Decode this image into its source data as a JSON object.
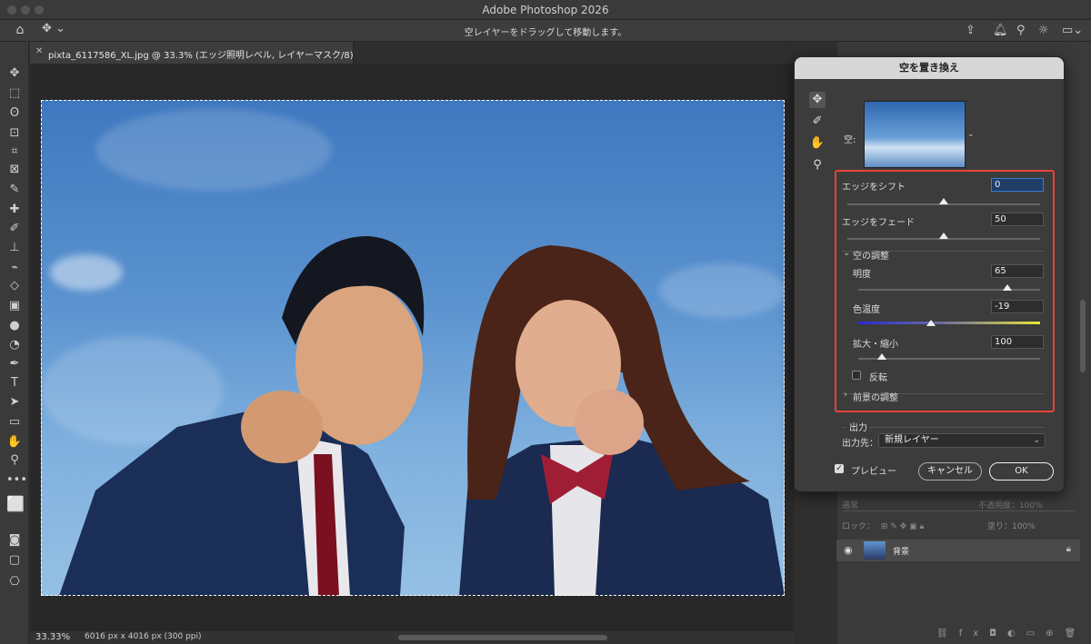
{
  "app": {
    "title": "Adobe Photoshop 2026"
  },
  "options_bar": {
    "hint": "空レイヤーをドラッグして移動します。"
  },
  "document": {
    "tab_title": "pixta_6117586_XL.jpg @ 33.3% (エッジ照明レベル, レイヤーマスク/8)",
    "zoom": "33.33%",
    "info": "6016 px x 4016 px (300 ppi)"
  },
  "dialog": {
    "title": "空を置き換え",
    "sky_label": "空:",
    "edge_shift": {
      "label": "エッジをシフト",
      "value": "0",
      "fraction": 0.5
    },
    "edge_fade": {
      "label": "エッジをフェード",
      "value": "50",
      "fraction": 0.5
    },
    "sky_adjust": {
      "header": "空の調整",
      "brightness": {
        "label": "明度",
        "value": "65",
        "fraction": 0.82
      },
      "temperature": {
        "label": "色温度",
        "value": "-19",
        "fraction": 0.4
      },
      "scale": {
        "label": "拡大・縮小",
        "value": "100",
        "fraction": 0.13
      },
      "flip_label": "反転"
    },
    "foreground_adjust": {
      "header": "前景の調整"
    },
    "output": {
      "header": "出力",
      "dest_label": "出力先：",
      "dest_value": "新規レイヤー"
    },
    "preview_label": "プレビュー",
    "cancel_label": "キャンセル",
    "ok_label": "OK"
  },
  "layers": {
    "blend_mode": "通常",
    "opacity_label": "不透明度：100%",
    "lock_label": "ロック：",
    "fill_label": "塗り：100%",
    "background_layer_name": "背景"
  },
  "colors": {
    "highlight_box": "#e8443a",
    "accent": "#3a7bd5"
  }
}
